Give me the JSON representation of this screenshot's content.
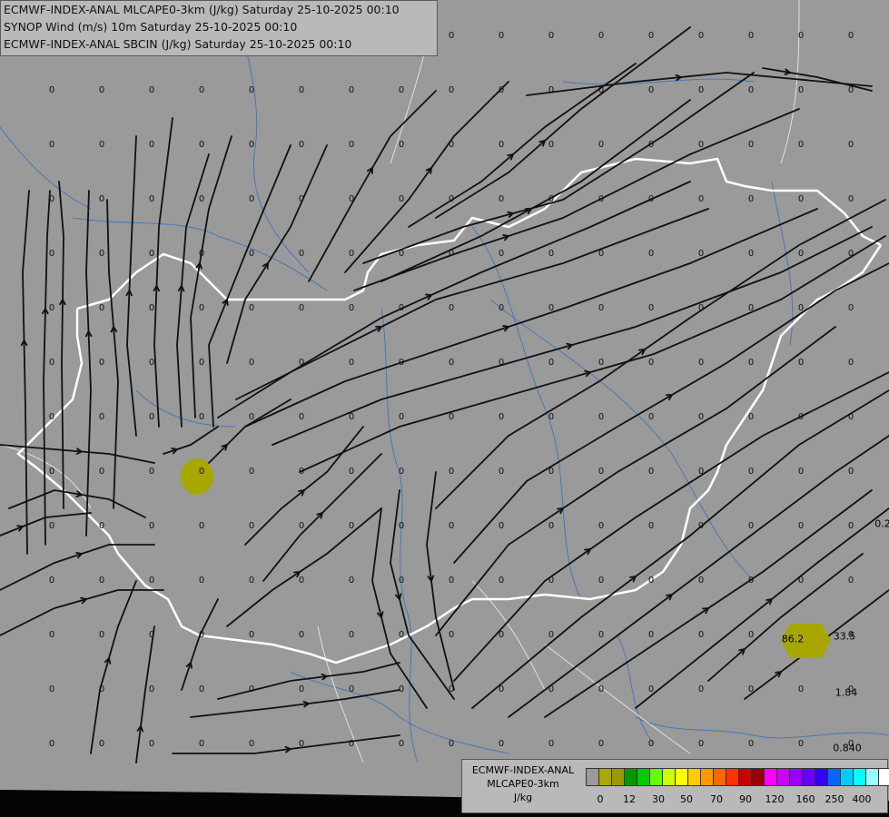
{
  "header": {
    "line1": "ECMWF-INDEX-ANAL MLCAPE0-3km (J/kg) Saturday 25-10-2025 00:10",
    "line2": "SYNOP Wind (m/s) 10m Saturday 25-10-2025 00:10",
    "line3": "ECMWF-INDEX-ANAL SBCIN (J/kg) Saturday 25-10-2025 00:10"
  },
  "legend": {
    "line1": "ECMWF-INDEX-ANAL",
    "line2": "MLCAPE0-3km",
    "line3": "J/kg",
    "colors": [
      "#9a9a9a",
      "#a8a800",
      "#9a9a00",
      "#009900",
      "#00cc00",
      "#66ff00",
      "#ccff00",
      "#ffff00",
      "#ffcc00",
      "#ff9900",
      "#ff6600",
      "#ff3300",
      "#cc0000",
      "#990000",
      "#ff00ff",
      "#cc00ff",
      "#9900ff",
      "#6600ff",
      "#3300ff",
      "#0066ff",
      "#00ccff",
      "#00ffff",
      "#99ffff",
      "#ffffff"
    ],
    "ticks": [
      "0",
      "12",
      "30",
      "50",
      "70",
      "90",
      "120",
      "160",
      "250",
      "400"
    ]
  },
  "values": {
    "big_blob_label": "86.2",
    "right_values": [
      "33.5",
      "1.84",
      "0.840",
      "0.2"
    ],
    "zero": "0"
  }
}
